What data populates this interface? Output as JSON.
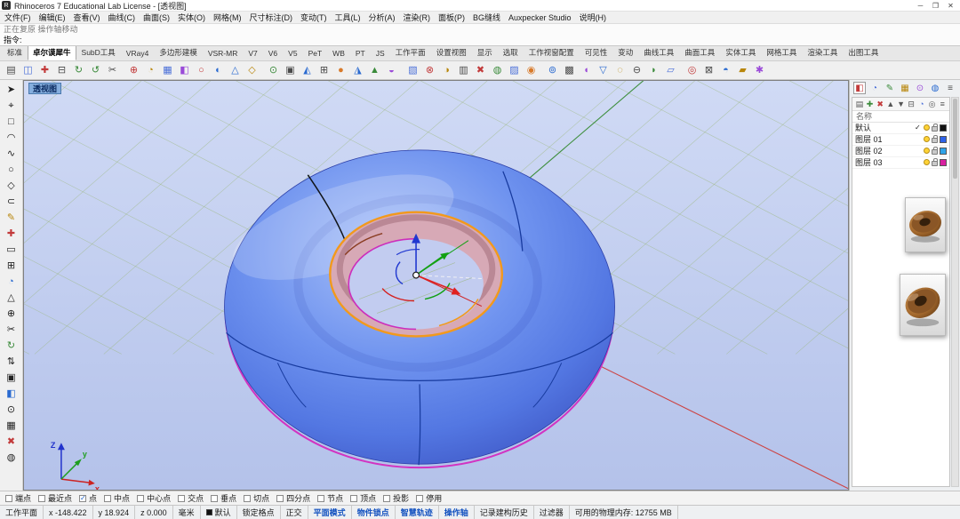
{
  "titlebar": {
    "app_icon": "R",
    "title": "Rhinoceros 7 Educational Lab License - [透视图]",
    "minimize": "─",
    "maximize": "❐",
    "close": "✕"
  },
  "menubar": {
    "items": [
      "文件(F)",
      "编辑(E)",
      "查看(V)",
      "曲线(C)",
      "曲面(S)",
      "实体(O)",
      "网格(M)",
      "尺寸标注(D)",
      "变动(T)",
      "工具(L)",
      "分析(A)",
      "渲染(R)",
      "面板(P)",
      "BG缝线",
      "Auxpecker Studio",
      "说明(H)"
    ]
  },
  "command": {
    "history": "正在复原 操作轴移动",
    "prompt": "指令:"
  },
  "tabstrip": {
    "tabs": [
      {
        "label": "标准"
      },
      {
        "label": "卓尔谟犀牛",
        "cls": "active"
      },
      {
        "label": "SubD工具"
      },
      {
        "label": "VRay4"
      },
      {
        "label": "多边形建模"
      },
      {
        "label": "VSR-MR"
      },
      {
        "label": "V7"
      },
      {
        "label": "V6"
      },
      {
        "label": "V5"
      },
      {
        "label": "PeT"
      },
      {
        "label": "WB"
      },
      {
        "label": "PT"
      },
      {
        "label": "JS"
      },
      {
        "label": "工作平面"
      },
      {
        "label": "设置视图"
      },
      {
        "label": "显示"
      },
      {
        "label": "选取"
      },
      {
        "label": "工作视窗配置"
      },
      {
        "label": "可见性"
      },
      {
        "label": "变动"
      },
      {
        "label": "曲线工具"
      },
      {
        "label": "曲面工具"
      },
      {
        "label": "实体工具"
      },
      {
        "label": "网格工具"
      },
      {
        "label": "渲染工具"
      },
      {
        "label": "出图工具"
      }
    ]
  },
  "toolbar": {
    "icons": [
      {
        "g": "▤",
        "c": "#4a4a4a"
      },
      {
        "g": "◫",
        "c": "#4a6fd8"
      },
      {
        "g": "✚",
        "c": "#c23a3a"
      },
      {
        "g": "⊟",
        "c": "#4a4a4a"
      },
      {
        "g": "↻",
        "c": "#3a8a3a"
      },
      {
        "g": "↺",
        "c": "#3a8a3a"
      },
      {
        "g": "✂",
        "c": "#4a4a4a"
      },
      {
        "g": "⊕",
        "c": "#c23a3a"
      },
      {
        "g": "◔",
        "c": "#b8860b"
      },
      {
        "g": "▦",
        "c": "#4a6fd8"
      },
      {
        "g": "◧",
        "c": "#9a4ad8"
      },
      {
        "g": "○",
        "c": "#c23a3a"
      },
      {
        "g": "◐",
        "c": "#2a6ad0"
      },
      {
        "g": "△",
        "c": "#2a6ad0"
      },
      {
        "g": "◇",
        "c": "#b8860b"
      },
      {
        "g": "⊙",
        "c": "#3a8a3a"
      },
      {
        "g": "▣",
        "c": "#4a4a4a"
      },
      {
        "g": "◭",
        "c": "#2a6ad0"
      },
      {
        "g": "⊞",
        "c": "#4a4a4a"
      },
      {
        "g": "●",
        "c": "#d87a2a"
      },
      {
        "g": "◮",
        "c": "#2a6ad0"
      },
      {
        "g": "▲",
        "c": "#3a8a3a"
      },
      {
        "g": "◒",
        "c": "#9a4ad8"
      },
      {
        "g": "▧",
        "c": "#4a6fd8"
      },
      {
        "g": "⊗",
        "c": "#c23a3a"
      },
      {
        "g": "◑",
        "c": "#b8860b"
      },
      {
        "g": "▥",
        "c": "#4a4a4a"
      },
      {
        "g": "✖",
        "c": "#c23a3a"
      },
      {
        "g": "◍",
        "c": "#3a8a3a"
      },
      {
        "g": "▨",
        "c": "#4a6fd8"
      },
      {
        "g": "◉",
        "c": "#d87a2a"
      },
      {
        "g": "⊚",
        "c": "#2a6ad0"
      },
      {
        "g": "▩",
        "c": "#4a4a4a"
      },
      {
        "g": "◖",
        "c": "#9a4ad8"
      },
      {
        "g": "▽",
        "c": "#2a6ad0"
      },
      {
        "g": "◌",
        "c": "#b8860b"
      },
      {
        "g": "⊖",
        "c": "#4a4a4a"
      },
      {
        "g": "◗",
        "c": "#3a8a3a"
      },
      {
        "g": "▱",
        "c": "#4a6fd8"
      },
      {
        "g": "◎",
        "c": "#c23a3a"
      },
      {
        "g": "⊠",
        "c": "#4a4a4a"
      },
      {
        "g": "◓",
        "c": "#2a6ad0"
      },
      {
        "g": "▰",
        "c": "#b8860b"
      },
      {
        "g": "✱",
        "c": "#9a4ad8"
      }
    ]
  },
  "sidebar": {
    "icons": [
      {
        "g": "➤",
        "c": "#222222"
      },
      {
        "g": "⌖",
        "c": "#222222"
      },
      {
        "g": "□",
        "c": "#222222"
      },
      {
        "g": "◠",
        "c": "#222222"
      },
      {
        "g": "∿",
        "c": "#222222"
      },
      {
        "g": "○",
        "c": "#222222"
      },
      {
        "g": "◇",
        "c": "#222222"
      },
      {
        "g": "⊂",
        "c": "#222222"
      },
      {
        "g": "✎",
        "c": "#b8860b"
      },
      {
        "g": "✚",
        "c": "#c23a3a"
      },
      {
        "g": "▭",
        "c": "#222222"
      },
      {
        "g": "⊞",
        "c": "#222222"
      },
      {
        "g": "◔",
        "c": "#2a6ad0"
      },
      {
        "g": "△",
        "c": "#222222"
      },
      {
        "g": "⊕",
        "c": "#222222"
      },
      {
        "g": "✂",
        "c": "#222222"
      },
      {
        "g": "↻",
        "c": "#3a8a3a"
      },
      {
        "g": "⇅",
        "c": "#222222"
      },
      {
        "g": "▣",
        "c": "#222222"
      },
      {
        "g": "◧",
        "c": "#2a6ad0"
      },
      {
        "g": "⊙",
        "c": "#222222"
      },
      {
        "g": "▦",
        "c": "#222222"
      },
      {
        "g": "✖",
        "c": "#c23a3a"
      },
      {
        "g": "◍",
        "c": "#222222"
      }
    ]
  },
  "viewport": {
    "label": "透视图",
    "axis_x": "x",
    "axis_y": "y",
    "axis_z": "Z"
  },
  "layer_panel": {
    "tabs": [
      {
        "g": "◧",
        "c": "#c23a3a",
        "cls": "active"
      },
      {
        "g": "◔",
        "c": "#4a6fd8"
      },
      {
        "g": "✎",
        "c": "#3a8a3a"
      },
      {
        "g": "▦",
        "c": "#b8860b"
      },
      {
        "g": "⊙",
        "c": "#9a4ad8"
      },
      {
        "g": "◍",
        "c": "#2a6ad0"
      },
      {
        "g": "≡",
        "c": "#4a4a4a"
      }
    ],
    "tools": [
      {
        "g": "▤",
        "c": "#555555"
      },
      {
        "g": "✚",
        "c": "#3a8a3a"
      },
      {
        "g": "✖",
        "c": "#c23a3a"
      },
      {
        "g": "▲",
        "c": "#555555"
      },
      {
        "g": "▼",
        "c": "#555555"
      },
      {
        "g": "⊟",
        "c": "#555555"
      },
      {
        "g": "◔",
        "c": "#4a6fd8"
      },
      {
        "g": "◎",
        "c": "#555555"
      },
      {
        "g": "≡",
        "c": "#555555"
      }
    ],
    "header": "名称",
    "rows": [
      {
        "name": "默认",
        "current": "✓",
        "color": "#111111"
      },
      {
        "name": "图层 01",
        "color": "#2e62e8"
      },
      {
        "name": "图层 02",
        "color": "#2fa3e8"
      },
      {
        "name": "图层 03",
        "color": "#d81fa0"
      }
    ]
  },
  "statusbar": {
    "osnaps": [
      {
        "label": "端点"
      },
      {
        "label": "最近点"
      },
      {
        "label": "点",
        "checked": true
      },
      {
        "label": "中点"
      },
      {
        "label": "中心点"
      },
      {
        "label": "交点"
      },
      {
        "label": "垂点"
      },
      {
        "label": "切点"
      },
      {
        "label": "四分点"
      },
      {
        "label": "节点"
      },
      {
        "label": "顶点"
      },
      {
        "label": "投影"
      },
      {
        "label": "停用"
      }
    ],
    "cells": [
      {
        "label": "工作平面"
      },
      {
        "label": "x -148.422"
      },
      {
        "label": "y 18.924"
      },
      {
        "label": "z 0.000"
      },
      {
        "label": "毫米"
      },
      {
        "label": "默认",
        "swatch": "#111111"
      },
      {
        "label": "锁定格点"
      },
      {
        "label": "正交"
      },
      {
        "label": "平面模式",
        "cls": "on"
      },
      {
        "label": "物件锁点",
        "cls": "on"
      },
      {
        "label": "智慧轨迹",
        "cls": "on"
      },
      {
        "label": "操作轴",
        "cls": "on"
      },
      {
        "label": "记录建构历史"
      },
      {
        "label": "过滤器"
      },
      {
        "label": "可用的物理内存: 12755 MB"
      }
    ]
  }
}
